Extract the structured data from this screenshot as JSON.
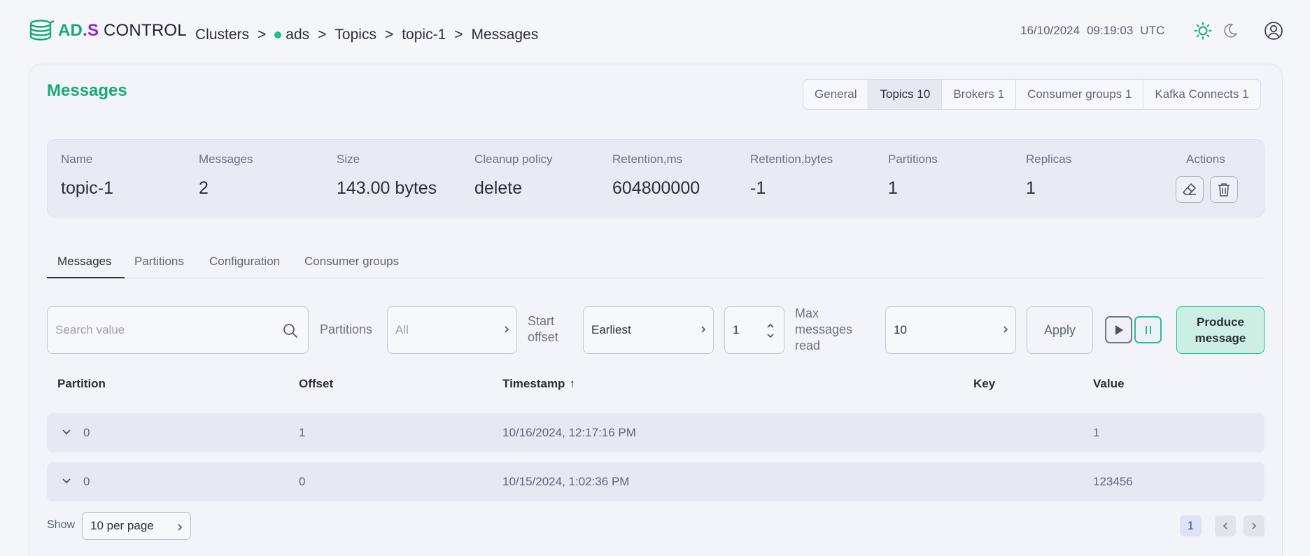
{
  "header": {
    "logo": {
      "part1": "AD",
      "part2": ".S",
      "part3": " CONTROL"
    },
    "breadcrumb": [
      "Clusters",
      "ads",
      "Topics",
      "topic-1",
      "Messages"
    ],
    "breadcrumb_separator": ">",
    "date": "16/10/2024",
    "time": "09:19:03",
    "timezone": "UTC",
    "icons": [
      "sun-icon",
      "moon-icon",
      "user-circle-icon"
    ]
  },
  "page": {
    "title": "Messages",
    "top_tabs": [
      {
        "label": "General",
        "active": false
      },
      {
        "label": "Topics 10",
        "active": true
      },
      {
        "label": "Brokers 1",
        "active": false
      },
      {
        "label": "Consumer groups 1",
        "active": false
      },
      {
        "label": "Kafka Connects 1",
        "active": false
      }
    ]
  },
  "topic_info": {
    "name_label": "Name",
    "name": "topic-1",
    "messages_label": "Messages",
    "messages": "2",
    "size_label": "Size",
    "size": "143.00 bytes",
    "cleanup_label": "Cleanup policy",
    "cleanup": "delete",
    "retention_ms_label": "Retention,ms",
    "retention_ms": "604800000",
    "retention_bytes_label": "Retention,bytes",
    "retention_bytes": "-1",
    "partitions_label": "Partitions",
    "partitions": "1",
    "replicas_label": "Replicas",
    "replicas": "1",
    "actions_label": "Actions"
  },
  "sub_tabs": [
    {
      "label": "Messages",
      "active": true
    },
    {
      "label": "Partitions",
      "active": false
    },
    {
      "label": "Configuration",
      "active": false
    },
    {
      "label": "Consumer groups",
      "active": false
    }
  ],
  "filters": {
    "search_placeholder": "Search value",
    "partitions_label": "Partitions",
    "partitions_placeholder": "All",
    "start_offset_label_1": "Start",
    "start_offset_label_2": "offset",
    "start_offset_value": "Earliest",
    "offset_number": "1",
    "max_label_1": "Max",
    "max_label_2": "messages",
    "max_label_3": "read",
    "max_value": "10",
    "apply_label": "Apply",
    "produce_label_1": "Produce",
    "produce_label_2": "message"
  },
  "table": {
    "columns": [
      "Partition",
      "Offset",
      "Timestamp",
      "Key",
      "Value"
    ],
    "sort_indicator": "↑",
    "rows": [
      {
        "partition": "0",
        "offset": "1",
        "timestamp": "10/16/2024, 12:17:16 PM",
        "key": "",
        "value": "1"
      },
      {
        "partition": "0",
        "offset": "0",
        "timestamp": "10/15/2024, 1:02:36 PM",
        "key": "",
        "value": "123456"
      }
    ]
  },
  "pagination": {
    "show_label": "Show",
    "per_page": "10 per page",
    "current_page": "1"
  },
  "colors": {
    "accent": "#19a979",
    "brand_s": "#8b25d8",
    "status_dot": "#1dbf8c"
  }
}
